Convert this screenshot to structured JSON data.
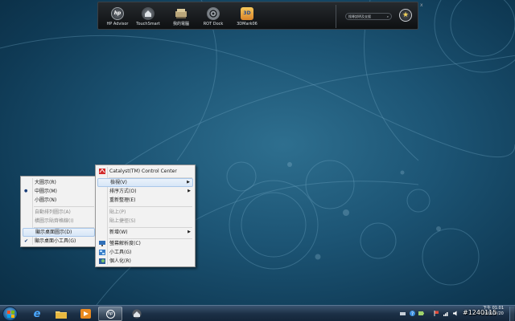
{
  "dock": {
    "items": [
      {
        "label": "HP Advisor",
        "icon": "hp-logo-icon"
      },
      {
        "label": "TouchSmart",
        "icon": "touchsmart-icon"
      },
      {
        "label": "我的電腦",
        "icon": "computer-icon"
      },
      {
        "label": "ROT Dock",
        "icon": "rot-dock-icon"
      },
      {
        "label": "3DMark06",
        "icon": "3dmark-icon"
      }
    ],
    "search_placeholder": "搜尋說明及支援",
    "favorite_icon": "star-icon",
    "close": "x"
  },
  "view_menu": {
    "items": [
      {
        "label": "大圖示(R)",
        "state": "normal"
      },
      {
        "label": "中圖示(M)",
        "state": "selected"
      },
      {
        "label": "小圖示(N)",
        "state": "normal"
      },
      {
        "label": "自動排列圖示(A)",
        "state": "disabled"
      },
      {
        "label": "橫圖示貼齊格線(I)",
        "state": "disabled"
      },
      {
        "label": "顯示桌面圖示(D)",
        "state": "highlighted"
      },
      {
        "label": "顯示桌面小工具(G)",
        "state": "checked"
      }
    ]
  },
  "desktop_menu": {
    "items": [
      {
        "label": "Catalyst(TM) Control Center",
        "icon": "catalyst-icon"
      },
      {
        "label": "檢視(V)",
        "submenu": true,
        "state": "highlighted"
      },
      {
        "label": "排序方式(O)",
        "submenu": true
      },
      {
        "label": "重新整理(E)"
      },
      {
        "label": "貼上(P)",
        "state": "disabled"
      },
      {
        "label": "貼上捷徑(S)",
        "state": "disabled"
      },
      {
        "label": "新增(W)",
        "submenu": true
      },
      {
        "label": "螢幕解析度(C)",
        "icon": "display-icon"
      },
      {
        "label": "小工具(G)",
        "icon": "gadgets-icon"
      },
      {
        "label": "個人化(R)",
        "icon": "personalize-icon"
      }
    ]
  },
  "taskbar": {
    "pinned": [
      "internet-explorer-icon",
      "folder-icon",
      "media-player-icon",
      "hp-icon",
      "touchsmart-icon"
    ],
    "tray_icons": [
      "network-icon",
      "help-icon",
      "battery-icon",
      "flag-icon",
      "wifi-icon",
      "volume-icon"
    ],
    "clock_time": "下午 01:01",
    "clock_date": "2009/6/20"
  },
  "watermark": "#1240115",
  "colors": {
    "desktop": "#1c5474",
    "menu_bg": "#f2f2f2",
    "highlight": "#d7e6f7",
    "dock_bg": "#15181b",
    "taskbar": "#1b2f45"
  }
}
